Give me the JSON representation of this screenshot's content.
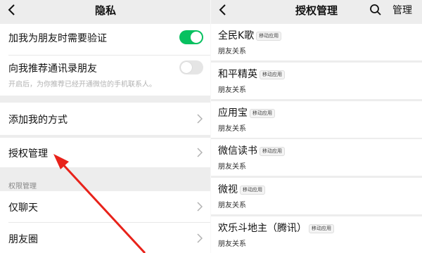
{
  "privacy": {
    "title": "隐私",
    "rows": {
      "friend_verify": "加我为朋友时需要验证",
      "recommend_contacts": "向我推荐通讯录朋友",
      "recommend_hint": "开启后，为你推荐已经开通微信的手机联系人。",
      "add_methods": "添加我的方式",
      "auth_manage": "授权管理",
      "perm_section": "权限管理",
      "chat_only": "仅聊天",
      "moments": "朋友圈"
    },
    "toggles": {
      "friend_verify": true,
      "recommend_contacts": false
    },
    "accent_color": "#07c160"
  },
  "auth": {
    "title": "授权管理",
    "manage_label": "管理",
    "apps": [
      {
        "name": "全民K歌",
        "tag": "移动应用",
        "permission": "朋友关系"
      },
      {
        "name": "和平精英",
        "tag": "移动应用",
        "permission": "朋友关系"
      },
      {
        "name": "应用宝",
        "tag": "移动应用",
        "permission": "朋友关系"
      },
      {
        "name": "微信读书",
        "tag": "移动应用",
        "permission": "朋友关系"
      },
      {
        "name": "微视",
        "tag": "移动应用",
        "permission": "朋友关系"
      },
      {
        "name": "欢乐斗地主（腾讯）",
        "tag": "移动应用",
        "permission": "朋友关系"
      }
    ]
  },
  "icons": [
    "back-icon",
    "chevron-right-icon",
    "search-icon"
  ],
  "annotation_arrow_color": "#e8221a"
}
